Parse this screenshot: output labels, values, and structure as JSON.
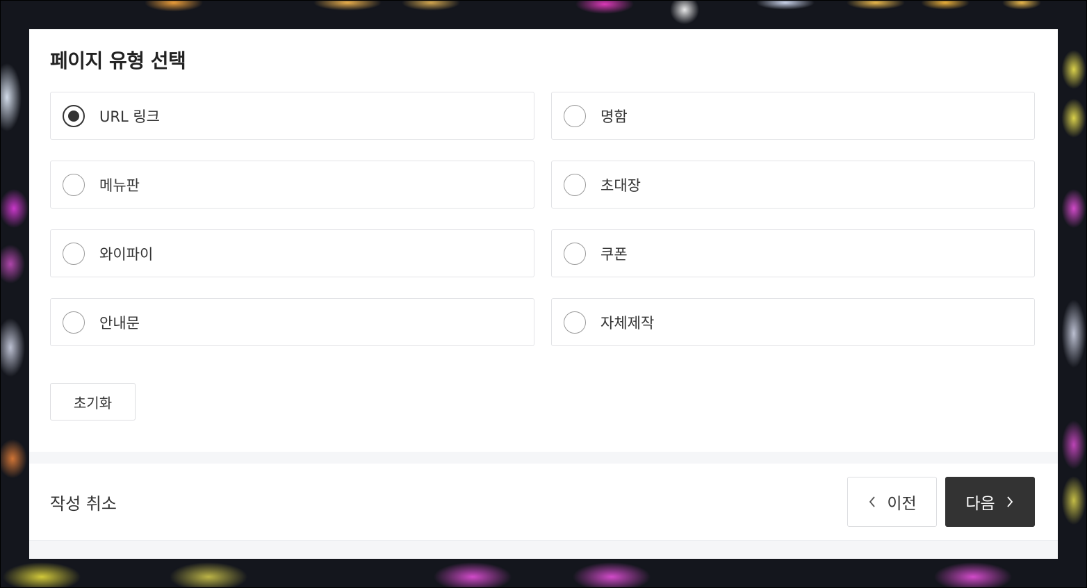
{
  "modal": {
    "title": "페이지 유형 선택",
    "selected_index": 0,
    "options": [
      {
        "label": "URL 링크",
        "selected": true
      },
      {
        "label": "명함",
        "selected": false
      },
      {
        "label": "메뉴판",
        "selected": false
      },
      {
        "label": "초대장",
        "selected": false
      },
      {
        "label": "와이파이",
        "selected": false
      },
      {
        "label": "쿠폰",
        "selected": false
      },
      {
        "label": "안내문",
        "selected": false
      },
      {
        "label": "자체제작",
        "selected": false
      }
    ],
    "reset_label": "초기화"
  },
  "footer": {
    "cancel_label": "작성 취소",
    "prev_label": "이전",
    "next_label": "다음"
  },
  "colors": {
    "primary_button": "#333333",
    "border": "#e2e3e6",
    "band": "#f5f6f8"
  },
  "icons": {
    "prev": "chevron-left-icon",
    "next": "chevron-right-icon",
    "radio_selected": "radio-checked-icon",
    "radio_unselected": "radio-unchecked-icon"
  }
}
